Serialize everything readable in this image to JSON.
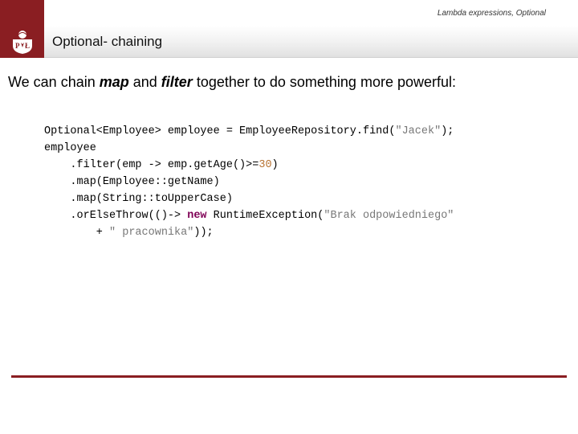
{
  "header": {
    "breadcrumb": "Lambda expressions, Optional",
    "title": "Optional- chaining"
  },
  "body": {
    "intro_pre": "We can chain ",
    "intro_map": "map",
    "intro_mid": " and ",
    "intro_filter": "filter",
    "intro_post": " together to do something more powerful:"
  },
  "code": {
    "l1a": "Optional<Employee> employee = EmployeeRepository.find(",
    "l1s": "\"Jacek\"",
    "l1b": ");",
    "l2": "employee",
    "l3a": "    .filter(emp -> emp.getAge()>=",
    "l3n": "30",
    "l3b": ")",
    "l4": "    .map(Employee::getName)",
    "l5": "    .map(String::toUpperCase)",
    "l6a": "    .orElseThrow(()-> ",
    "l6kw": "new",
    "l6b": " RuntimeException(",
    "l6s": "\"Brak odpowiedniego\"",
    "l7a": "        + ",
    "l7s": "\" pracownika\"",
    "l7b": "));"
  }
}
